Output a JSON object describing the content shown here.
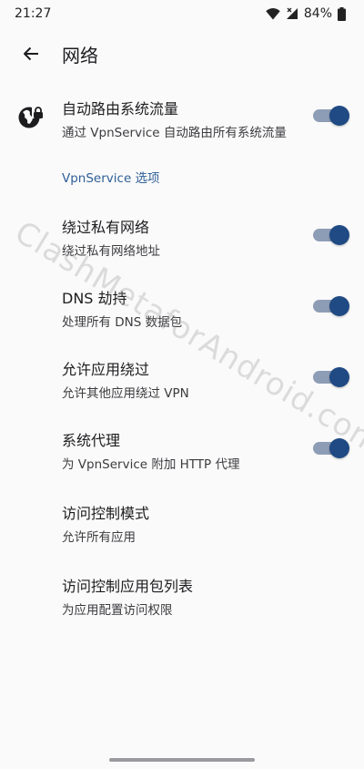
{
  "status_bar": {
    "time": "21:27",
    "battery": "84%",
    "icons": [
      "wifi-icon",
      "signal-icon",
      "battery-icon"
    ]
  },
  "app_bar": {
    "back_icon": "arrow-back-icon",
    "title": "网络"
  },
  "settings": {
    "auto_route": {
      "title": "自动路由系统流量",
      "summary": "通过 VpnService 自动路由所有系统流量",
      "icon": "vpn-globe-lock-icon",
      "enabled": true
    },
    "section_header": "VpnService 选项",
    "bypass_private": {
      "title": "绕过私有网络",
      "summary": "绕过私有网络地址",
      "enabled": true
    },
    "dns_hijack": {
      "title": "DNS 劫持",
      "summary": "处理所有 DNS 数据包",
      "enabled": true
    },
    "allow_bypass": {
      "title": "允许应用绕过",
      "summary": "允许其他应用绕过 VPN",
      "enabled": true
    },
    "system_proxy": {
      "title": "系统代理",
      "summary": "为 VpnService 附加 HTTP 代理",
      "enabled": true
    },
    "access_control_mode": {
      "title": "访问控制模式",
      "summary": "允许所有应用"
    },
    "access_control_list": {
      "title": "访问控制应用包列表",
      "summary": "为应用配置访问权限"
    }
  },
  "watermark": "ClashMetaforAndroid.com",
  "colors": {
    "accent": "#1f4a84",
    "switch_track": "#8e9db6",
    "section_header": "#2f5f97",
    "background": "#fafafa"
  }
}
